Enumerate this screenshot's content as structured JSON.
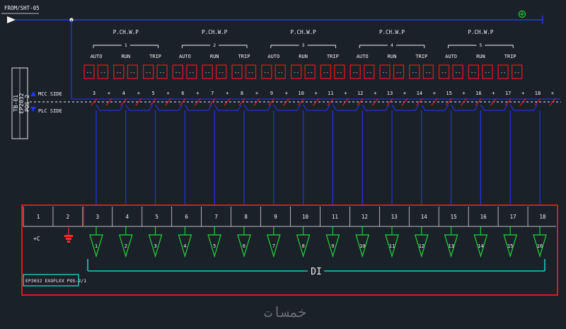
{
  "header": {
    "from_sheet": "FROM/SHT-05"
  },
  "pumps": [
    {
      "title": "P.CH.W.P",
      "number": "1",
      "signals": [
        "AUTO",
        "RUN",
        "TRIP"
      ]
    },
    {
      "title": "P.CH.W.P",
      "number": "2",
      "signals": [
        "AUTO",
        "RUN",
        "TRIP"
      ]
    },
    {
      "title": "P.CH.W.P",
      "number": "3",
      "signals": [
        "AUTO",
        "RUN",
        "TRIP"
      ]
    },
    {
      "title": "P.CH.W.P",
      "number": "4",
      "signals": [
        "AUTO",
        "RUN",
        "TRIP"
      ]
    },
    {
      "title": "P.CH.W.P",
      "number": "5",
      "signals": [
        "AUTO",
        "RUN",
        "TRIP"
      ]
    }
  ],
  "status_box_text": "--",
  "terminal_block": {
    "tag_lines": [
      "TB-01",
      "EP2032",
      "POS-2"
    ],
    "mcc_side": "MCC SIDE",
    "plc_side": "PLC SIDE",
    "terminals": [
      "3",
      "4",
      "5",
      "6",
      "7",
      "8",
      "9",
      "10",
      "11",
      "12",
      "13",
      "14",
      "15",
      "16",
      "17",
      "18"
    ],
    "plus_sign": "+"
  },
  "module": {
    "terminals": [
      "1",
      "2",
      "3",
      "4",
      "5",
      "6",
      "7",
      "8",
      "9",
      "10",
      "11",
      "12",
      "13",
      "14",
      "15",
      "16",
      "17",
      "18"
    ],
    "common_label": "+C",
    "inputs": [
      "1",
      "2",
      "3",
      "4",
      "5",
      "6",
      "7",
      "8",
      "9",
      "10",
      "11",
      "12",
      "13",
      "14",
      "15",
      "16"
    ],
    "group_label": "DI",
    "module_tag": "EP2032 EXOFLEX POS-2/1"
  },
  "watermark": "خمسات",
  "colors": {
    "background": "#1b2129",
    "wire_blue": "#1f35ff",
    "frame_red": "#e0161e",
    "input_green": "#21d63a",
    "bracket_cyan": "#1ec8c0",
    "text_white": "#f2f2f2",
    "ground_red": "#ff2a2a"
  }
}
